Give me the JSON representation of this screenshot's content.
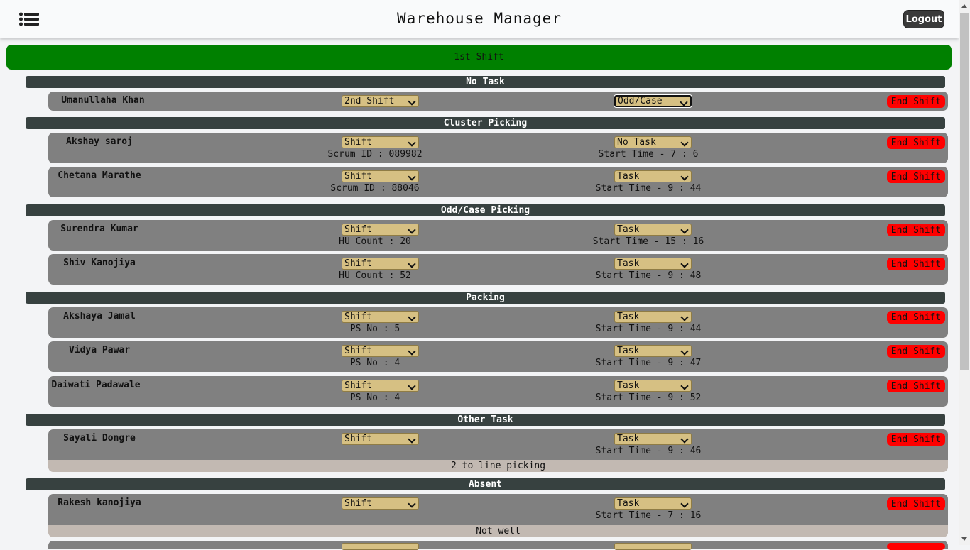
{
  "header": {
    "title": "Warehouse Manager",
    "logout_label": "Logout"
  },
  "shift_banner": "1st Shift",
  "groups": [
    {
      "title": "No Task",
      "employees": [
        {
          "name": "Umanullaha Khan",
          "shift": "2nd Shift",
          "task": "Odd/Case",
          "end_label": "End Shift"
        }
      ]
    },
    {
      "title": "Cluster Picking",
      "employees": [
        {
          "name": "Akshay saroj",
          "shift": "Shift",
          "task": "No Task",
          "info": "Scrum ID : 089982",
          "start_time": "Start Time - 7 : 6",
          "end_label": "End Shift"
        },
        {
          "name": "Chetana Marathe",
          "shift": "Shift",
          "task": "Task",
          "info": "Scrum ID : 88046",
          "start_time": "Start Time - 9 : 44",
          "end_label": "End Shift"
        }
      ]
    },
    {
      "title": "Odd/Case Picking",
      "employees": [
        {
          "name": "Surendra Kumar",
          "shift": "Shift",
          "task": "Task",
          "info": "HU Count : 20",
          "start_time": "Start Time - 15 : 16",
          "end_label": "End Shift"
        },
        {
          "name": "Shiv Kanojiya",
          "shift": "Shift",
          "task": "Task",
          "info": "HU Count : 52",
          "start_time": "Start Time - 9 : 48",
          "end_label": "End Shift"
        }
      ]
    },
    {
      "title": "Packing",
      "employees": [
        {
          "name": "Akshaya Jamal",
          "shift": "Shift",
          "task": "Task",
          "info": "PS No : 5",
          "start_time": "Start Time - 9 : 44",
          "end_label": "End Shift"
        },
        {
          "name": "Vidya Pawar",
          "shift": "Shift",
          "task": "Task",
          "info": "PS No : 4",
          "start_time": "Start Time - 9 : 47",
          "end_label": "End Shift"
        },
        {
          "name": "Daiwati Padawale",
          "shift": "Shift",
          "task": "Task",
          "info": "PS No : 4",
          "start_time": "Start Time - 9 : 52",
          "end_label": "End Shift"
        }
      ]
    },
    {
      "title": "Other Task",
      "employees": [
        {
          "name": "Sayali Dongre",
          "shift": "Shift",
          "task": "Task",
          "start_time": "Start Time - 9 : 46",
          "note": "2 to line picking",
          "end_label": "End Shift"
        }
      ]
    },
    {
      "title": "Absent",
      "employees": [
        {
          "name": "Rakesh kanojiya",
          "shift": "Shift",
          "task": "Task",
          "start_time": "Start Time - 7 : 16",
          "note": "Not well",
          "end_label": "End Shift"
        }
      ]
    }
  ],
  "icons": {
    "menu": "list-menu-icon",
    "dropdown": "chevron-down-icon"
  },
  "colors": {
    "shift_banner": "#008000",
    "group_header": "#374140",
    "row_bg": "#808080",
    "select_bg": "#d6c083",
    "end_button": "#ff0000",
    "note_bg": "#c2b9b2"
  }
}
